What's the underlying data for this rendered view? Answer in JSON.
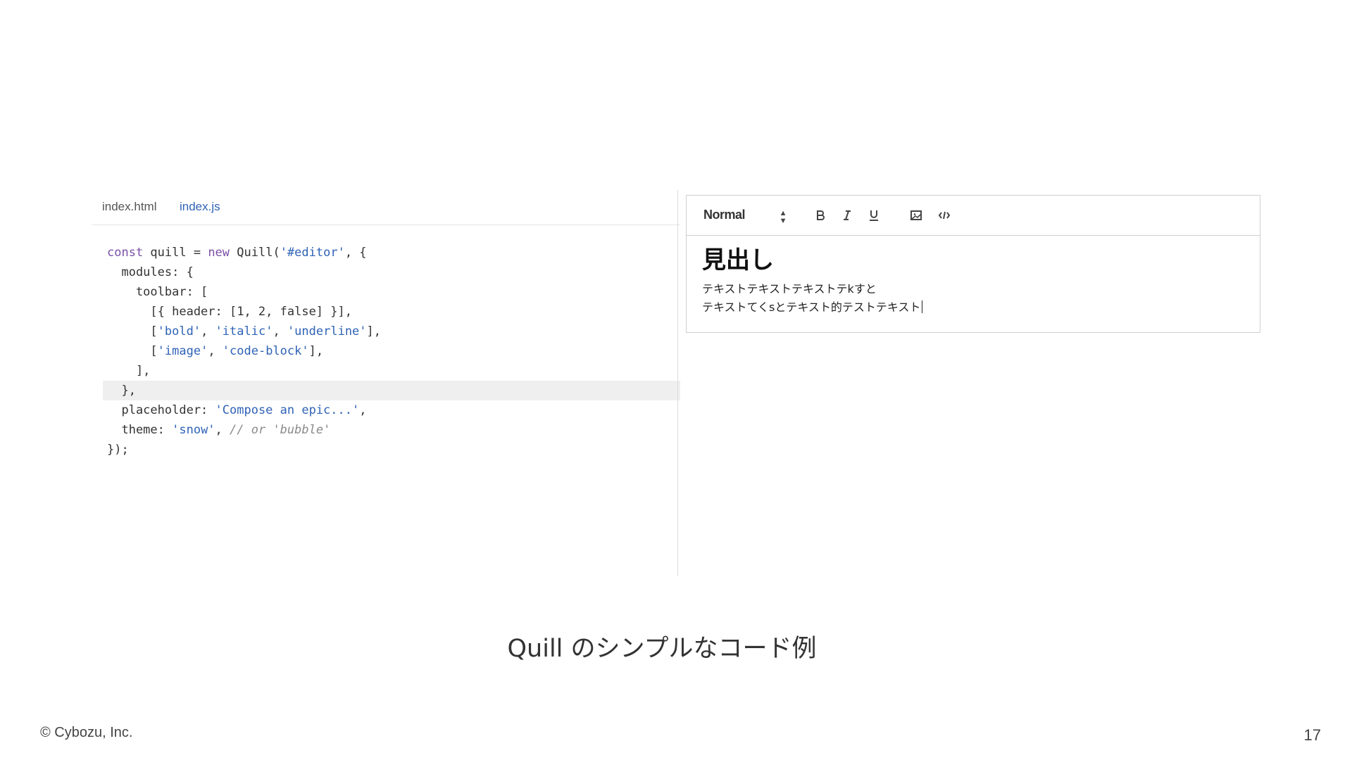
{
  "code_panel": {
    "tabs": [
      {
        "label": "index.html"
      },
      {
        "label": "index.js"
      }
    ],
    "lines": [
      {
        "parts": [
          [
            "kw",
            "const"
          ],
          [
            "plain",
            " quill = "
          ],
          [
            "kw",
            "new"
          ],
          [
            "plain",
            " Quill("
          ],
          [
            "str",
            "'#editor'"
          ],
          [
            "plain",
            ", {"
          ]
        ]
      },
      {
        "parts": [
          [
            "plain",
            "  modules: {"
          ]
        ]
      },
      {
        "parts": [
          [
            "plain",
            "    toolbar: ["
          ]
        ]
      },
      {
        "parts": [
          [
            "plain",
            "      [{ header: [1, 2, false] }],"
          ]
        ]
      },
      {
        "parts": [
          [
            "plain",
            "      ["
          ],
          [
            "str",
            "'bold'"
          ],
          [
            "plain",
            ", "
          ],
          [
            "str",
            "'italic'"
          ],
          [
            "plain",
            ", "
          ],
          [
            "str",
            "'underline'"
          ],
          [
            "plain",
            "],"
          ]
        ]
      },
      {
        "parts": [
          [
            "plain",
            "      ["
          ],
          [
            "str",
            "'image'"
          ],
          [
            "plain",
            ", "
          ],
          [
            "str",
            "'code-block'"
          ],
          [
            "plain",
            "],"
          ]
        ]
      },
      {
        "parts": [
          [
            "plain",
            "    ],"
          ]
        ]
      },
      {
        "parts": [
          [
            "plain",
            "  },"
          ]
        ],
        "highlight": true
      },
      {
        "parts": [
          [
            "plain",
            "  placeholder: "
          ],
          [
            "str",
            "'Compose an epic...'"
          ],
          [
            "plain",
            ","
          ]
        ]
      },
      {
        "parts": [
          [
            "plain",
            "  theme: "
          ],
          [
            "str",
            "'snow'"
          ],
          [
            "plain",
            ", "
          ],
          [
            "cm",
            "// or 'bubble'"
          ]
        ]
      },
      {
        "parts": [
          [
            "plain",
            "});"
          ]
        ]
      }
    ]
  },
  "editor": {
    "toolbar": {
      "format_select": "Normal",
      "buttons": [
        {
          "name": "bold-button",
          "icon": "bold-icon"
        },
        {
          "name": "italic-button",
          "icon": "italic-icon"
        },
        {
          "name": "underline-button",
          "icon": "underline-icon"
        },
        {
          "name": "image-button",
          "icon": "image-icon"
        },
        {
          "name": "code-block-button",
          "icon": "code-block-icon"
        }
      ]
    },
    "heading": "見出し",
    "lines": [
      "テキストテキストテキストテkすと",
      "テキストてくsとテキスト的テストテキスト"
    ]
  },
  "caption": "Quill のシンプルなコード例",
  "footer": {
    "copyright": "© Cybozu, Inc.",
    "page_number": "17"
  }
}
